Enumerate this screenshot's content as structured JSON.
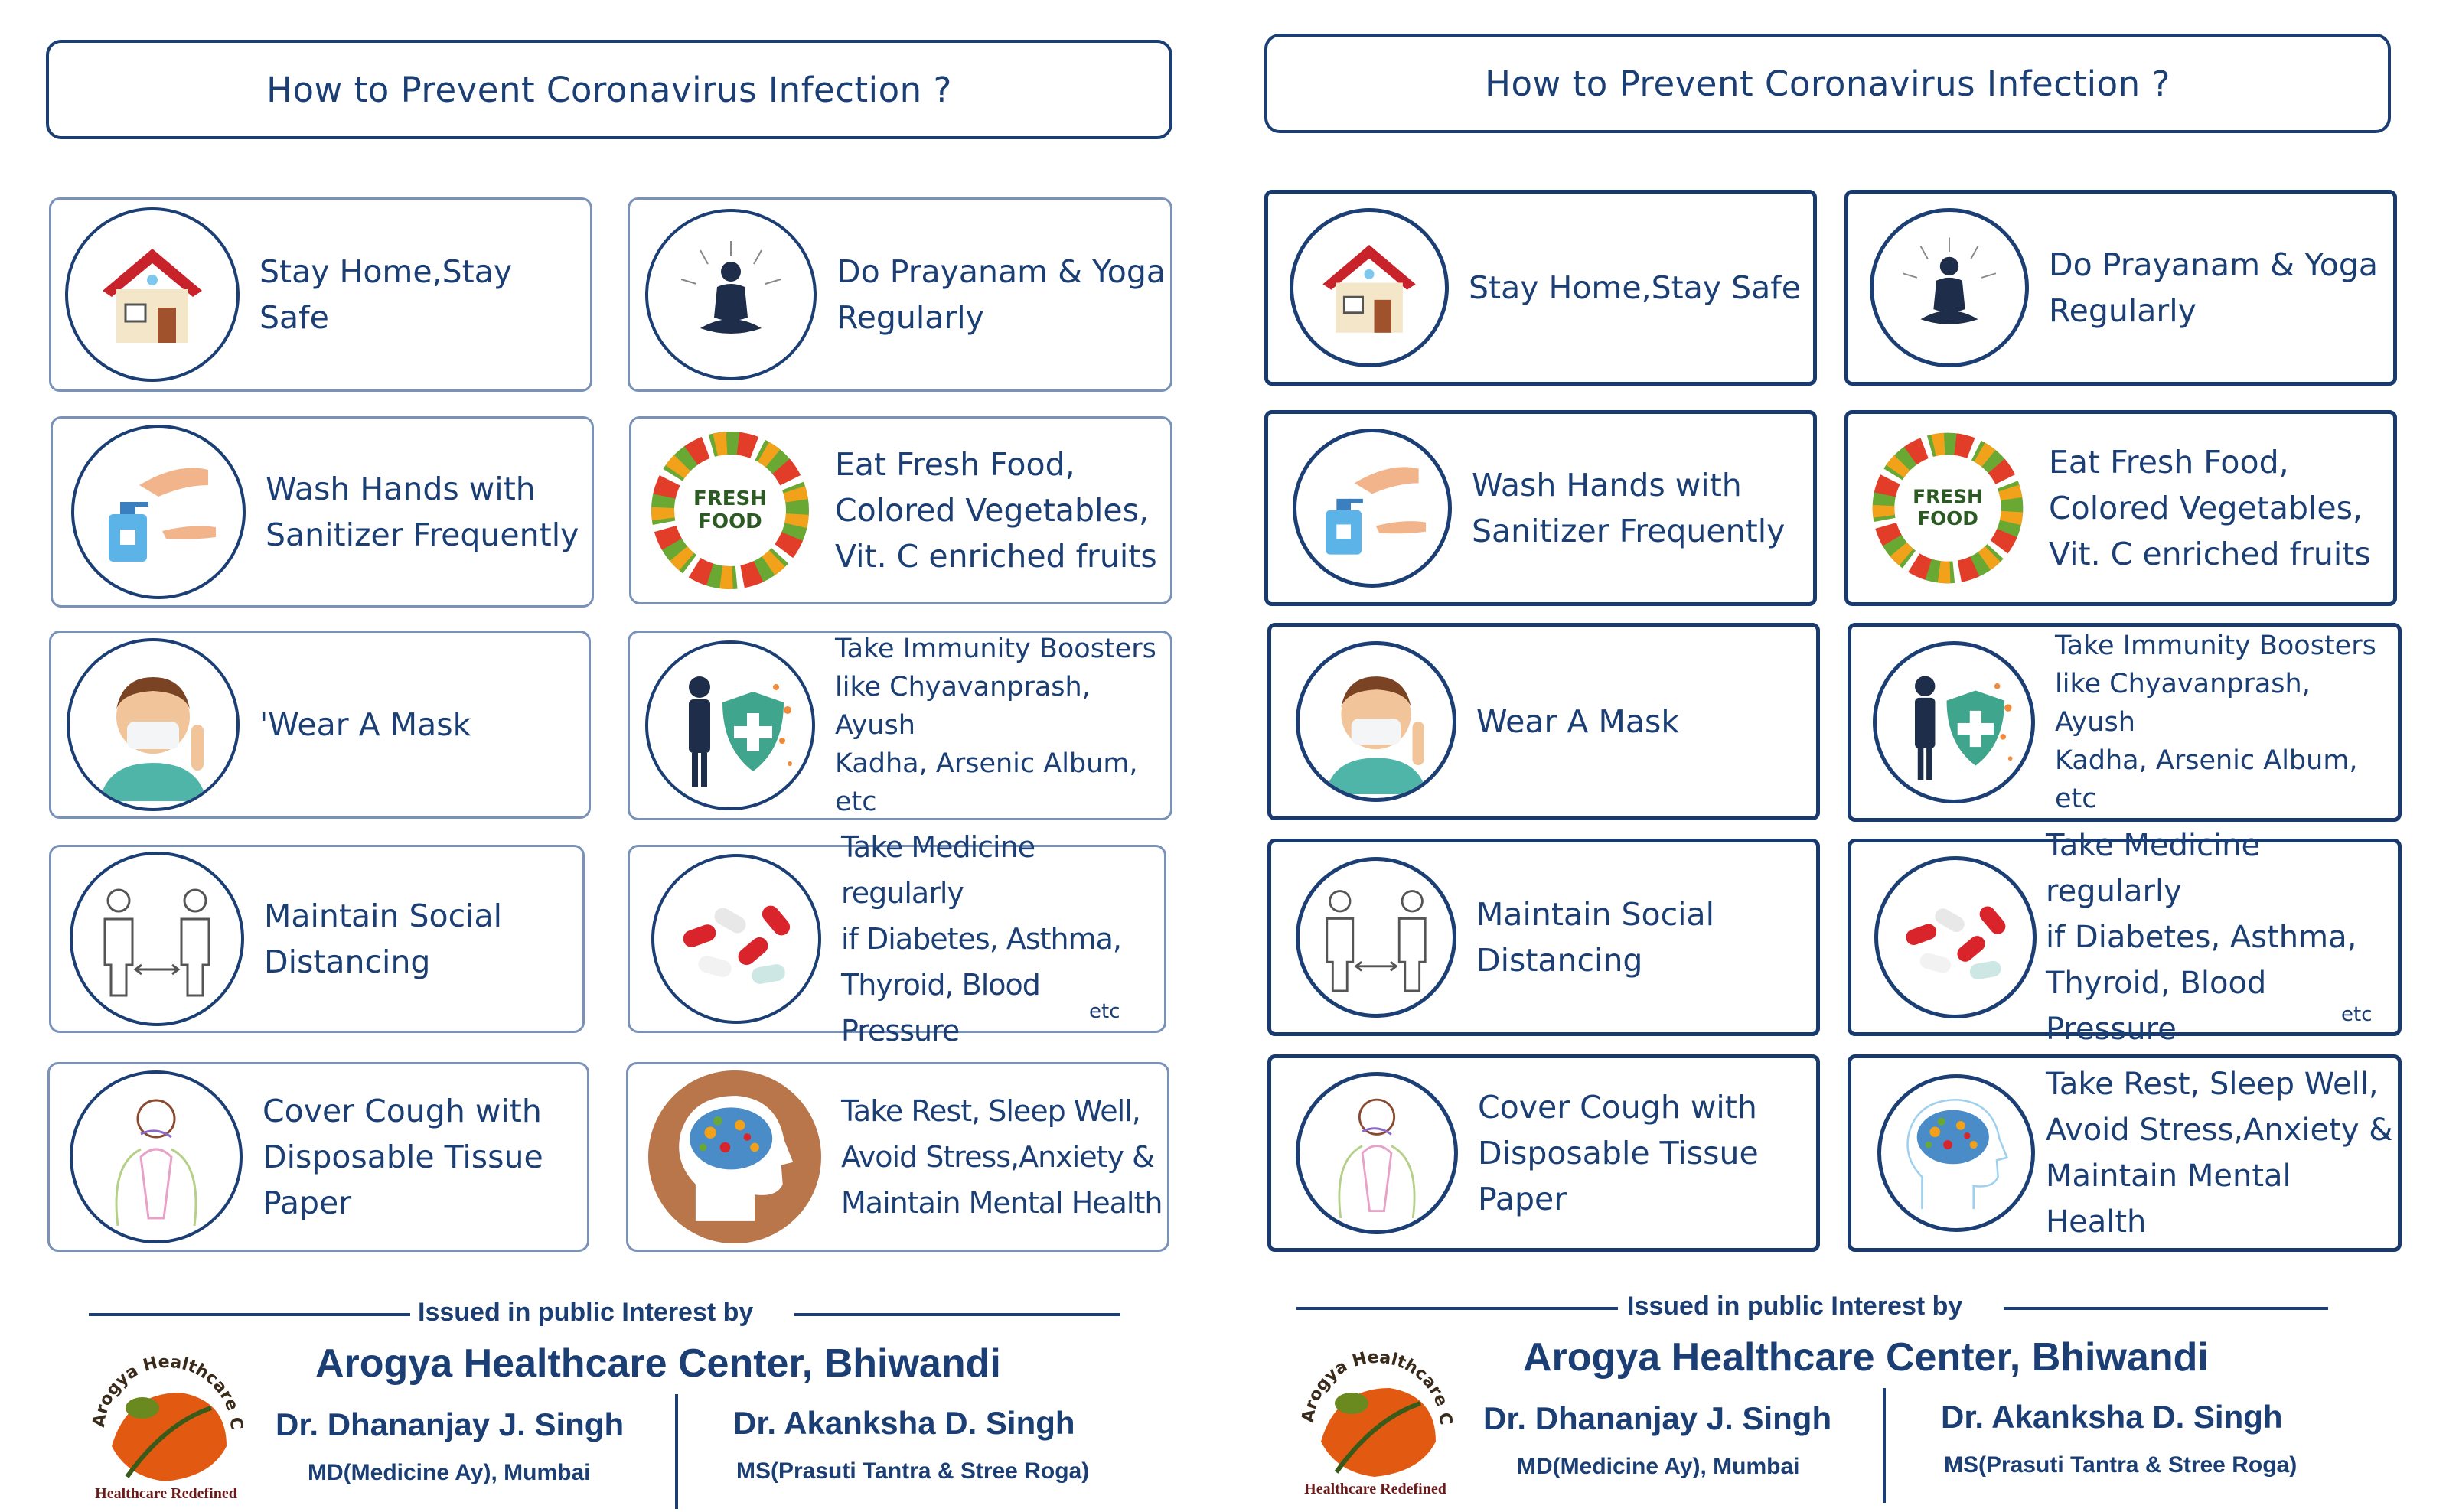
{
  "panels": [
    {
      "title": "How to Prevent Coronavirus Infection ?",
      "cards": [
        {
          "text": "Stay Home,Stay Safe",
          "icon": "house-icon"
        },
        {
          "text": "Do Prayanam & Yoga\nRegularly",
          "icon": "meditation-icon"
        },
        {
          "text": "Wash Hands with\nSanitizer Frequently",
          "icon": "sanitizer-hands-icon"
        },
        {
          "text": "Eat Fresh Food,\nColored Vegetables,\nVit. C enriched fruits",
          "icon": "fresh-food-icon",
          "icon_label": "FRESH\nFOOD"
        },
        {
          "text": "'Wear A Mask",
          "icon": "masked-person-icon"
        },
        {
          "text": "Take Immunity Boosters\nlike Chyavanprash, Ayush\nKadha, Arsenic Album, etc",
          "icon": "immunity-shield-icon"
        },
        {
          "text": "Maintain Social\nDistancing",
          "icon": "social-distance-icon"
        },
        {
          "text": "Take Medicine regularly\n if Diabetes,  Asthma,\nThyroid, Blood Pressure",
          "icon": "pills-icon",
          "note": "etc"
        },
        {
          "text": "Cover Cough with\nDisposable Tissue\nPaper",
          "icon": "cough-icon"
        },
        {
          "text": "Take Rest, Sleep Well,\nAvoid Stress,Anxiety &\nMaintain Mental Health",
          "icon": "brain-head-icon"
        }
      ],
      "footer": {
        "issued": "Issued in public Interest by",
        "center": "Arogya Healthcare Center, Bhiwandi",
        "doctor1_name": "Dr. Dhananjay J. Singh",
        "doctor1_qual": "MD(Medicine Ay), Mumbai",
        "doctor2_name": "Dr. Akanksha D. Singh",
        "doctor2_qual": "MS(Prasuti Tantra & Stree Roga)",
        "logo_arc": "Arogya Healthcare Center",
        "logo_tagline": "Healthcare Redefined"
      }
    },
    {
      "title": "How to Prevent Coronavirus Infection ?",
      "cards": [
        {
          "text": "Stay Home,Stay Safe",
          "icon": "house-icon"
        },
        {
          "text": "Do Prayanam & Yoga\nRegularly",
          "icon": "meditation-icon"
        },
        {
          "text": "Wash Hands with\nSanitizer Frequently",
          "icon": "sanitizer-hands-icon"
        },
        {
          "text": "Eat Fresh Food,\nColored Vegetables,\nVit. C enriched fruits",
          "icon": "fresh-food-icon",
          "icon_label": "FRESH\nFOOD"
        },
        {
          "text": "Wear A Mask",
          "icon": "masked-person-icon"
        },
        {
          "text": "Take Immunity Boosters\nlike Chyavanprash, Ayush\nKadha, Arsenic Album, etc",
          "icon": "immunity-shield-icon"
        },
        {
          "text": "Maintain Social\nDistancing",
          "icon": "social-distance-icon"
        },
        {
          "text": "Take Medicine regularly\n if Diabetes,  Asthma,\nThyroid, Blood Pressure",
          "icon": "pills-icon",
          "note": "etc"
        },
        {
          "text": "Cover Cough with\nDisposable Tissue\nPaper",
          "icon": "cough-icon"
        },
        {
          "text": "Take Rest, Sleep Well,\nAvoid Stress,Anxiety &\nMaintain Mental Health",
          "icon": "brain-head-icon"
        }
      ],
      "footer": {
        "issued": "Issued in public Interest by",
        "center": "Arogya Healthcare Center, Bhiwandi",
        "doctor1_name": "Dr. Dhananjay J. Singh",
        "doctor1_qual": "MD(Medicine Ay), Mumbai",
        "doctor2_name": "Dr. Akanksha D. Singh",
        "doctor2_qual": "MS(Prasuti Tantra & Stree Roga)",
        "logo_arc": "Arogya Healthcare Center",
        "logo_tagline": "Healthcare Redefined"
      }
    }
  ],
  "colors": {
    "primary": "#1b3f74",
    "logo_orange": "#e25a12",
    "logo_green": "#6a8a1f"
  }
}
